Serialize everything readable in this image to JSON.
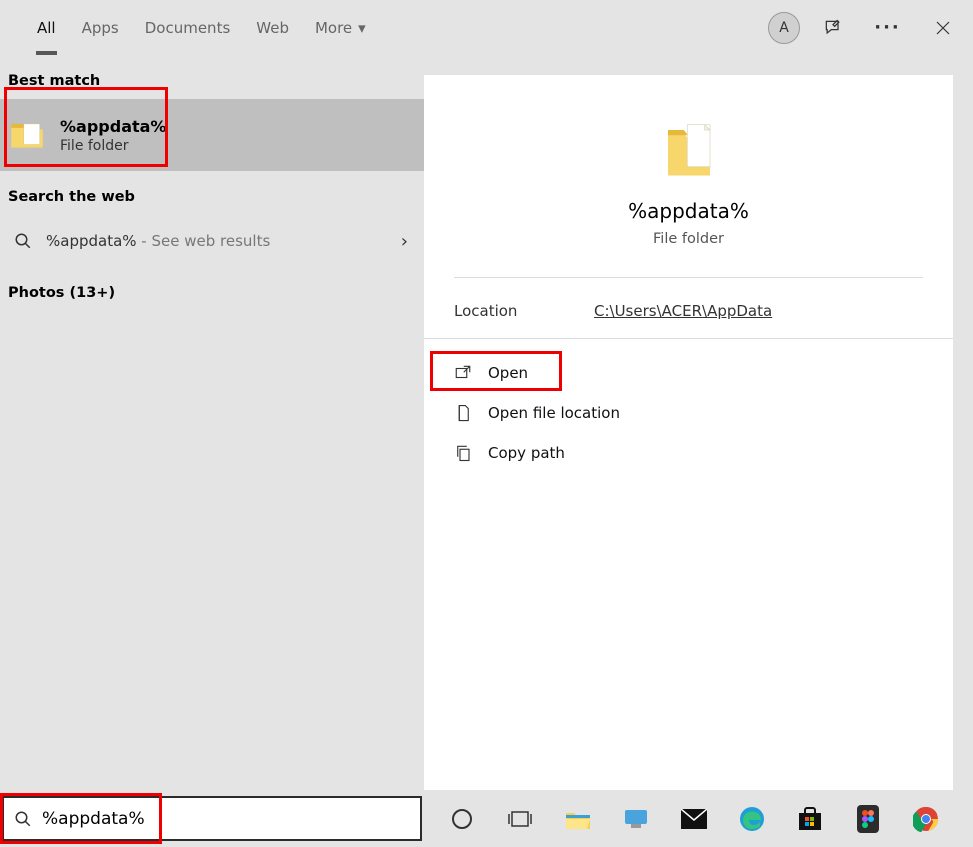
{
  "tabs": [
    "All",
    "Apps",
    "Documents",
    "Web",
    "More"
  ],
  "active_tab": 0,
  "avatar_letter": "A",
  "left": {
    "best_match_label": "Best match",
    "bm_title": "%appdata%",
    "bm_sub": "File folder",
    "search_web_label": "Search the web",
    "web_query": "%appdata%",
    "web_suffix": " - See web results",
    "photos_label": "Photos (13+)"
  },
  "right": {
    "title": "%appdata%",
    "sub": "File folder",
    "location_label": "Location",
    "location_value": "C:\\Users\\ACER\\AppData",
    "actions": {
      "open": "Open",
      "open_loc": "Open file location",
      "copy": "Copy path"
    }
  },
  "search_value": "%appdata%"
}
